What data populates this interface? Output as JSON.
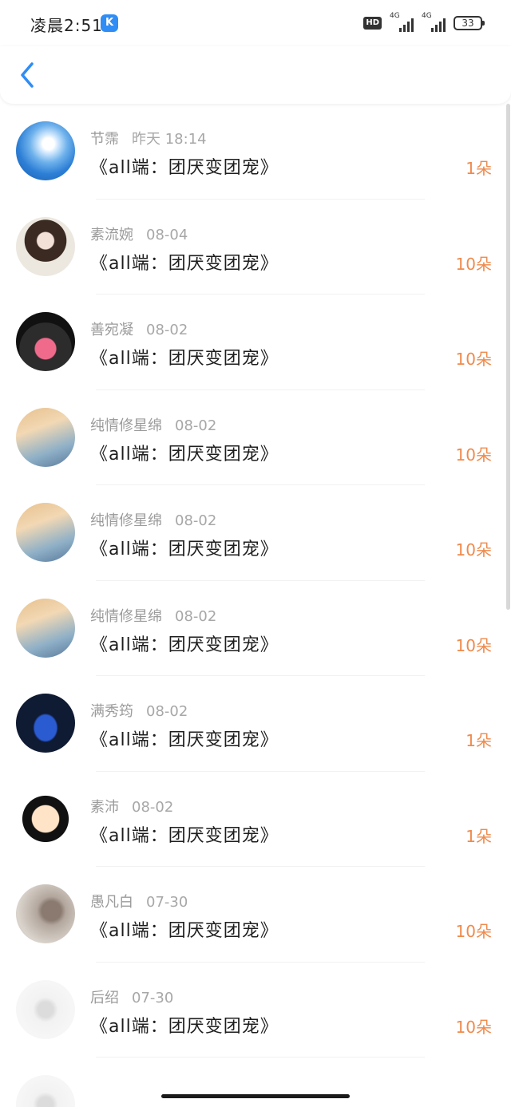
{
  "status_bar": {
    "time": "凌晨2:51",
    "app_icon_letter": "K",
    "hd_label": "HD",
    "network_1": "4G",
    "network_2": "4G",
    "battery": "33"
  },
  "nav": {
    "back_icon": "chevron-left-icon"
  },
  "colors": {
    "accent_blue": "#2f8df5",
    "amount_orange": "#ef8a4c",
    "sender_gray": "#9b9b9b"
  },
  "gifts": [
    {
      "sender": "节霈",
      "date": "昨天 18:14",
      "title": "《all端：团厌变团宠》",
      "amount": "1朵"
    },
    {
      "sender": "素流婉",
      "date": "08-04",
      "title": "《all端：团厌变团宠》",
      "amount": "10朵"
    },
    {
      "sender": "善宛凝",
      "date": "08-02",
      "title": "《all端：团厌变团宠》",
      "amount": "10朵"
    },
    {
      "sender": "纯情修星绵",
      "date": "08-02",
      "title": "《all端：团厌变团宠》",
      "amount": "10朵"
    },
    {
      "sender": "纯情修星绵",
      "date": "08-02",
      "title": "《all端：团厌变团宠》",
      "amount": "10朵"
    },
    {
      "sender": "纯情修星绵",
      "date": "08-02",
      "title": "《all端：团厌变团宠》",
      "amount": "10朵"
    },
    {
      "sender": "满秀筠",
      "date": "08-02",
      "title": "《all端：团厌变团宠》",
      "amount": "1朵"
    },
    {
      "sender": "素沛",
      "date": "08-02",
      "title": "《all端：团厌变团宠》",
      "amount": "1朵"
    },
    {
      "sender": "愚凡白",
      "date": "07-30",
      "title": "《all端：团厌变团宠》",
      "amount": "10朵"
    },
    {
      "sender": "后绍",
      "date": "07-30",
      "title": "《all端：团厌变团宠》",
      "amount": "10朵"
    }
  ]
}
